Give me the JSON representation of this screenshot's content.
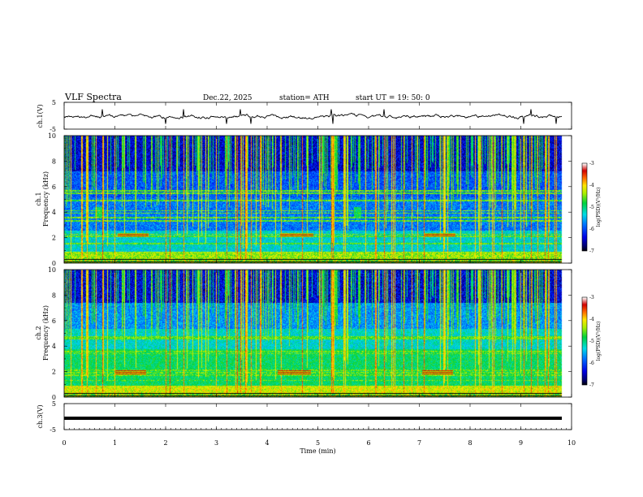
{
  "header": {
    "title": "VLF  Spectra",
    "date": "Dec.22, 2025",
    "station": "station= ATH",
    "start": "start  UT  =    19: 50: 0"
  },
  "chart_data": [
    {
      "id": "ch1-waveform",
      "type": "line",
      "ylabel": "ch.1(V)",
      "ylim": [
        -5,
        5
      ],
      "yticks": [
        5,
        -5
      ],
      "xlim": [
        0,
        10
      ],
      "data_extent_min": [
        0,
        9.8
      ],
      "series": [
        {
          "color": "#000000"
        }
      ]
    },
    {
      "id": "ch1-spectrogram",
      "type": "heatmap",
      "ylabel": "ch.1\nFrequency  (kHz)",
      "ylim": [
        0,
        10
      ],
      "yticks": [
        0,
        2,
        4,
        6,
        8,
        10
      ],
      "xlim": [
        0,
        10
      ],
      "data_extent_min": [
        0,
        9.8
      ],
      "colorbar": {
        "label": "log(PSD)(V²/Hz)",
        "range": [
          -7,
          -3
        ],
        "ticks": [
          "-3",
          "-4",
          "-5",
          "-6",
          "-7"
        ]
      },
      "features": {
        "tone_lines_khz": [
          5.7,
          5.5,
          4.95,
          4.9,
          4.15,
          3.95,
          3.6,
          3.35,
          2.3,
          2.15,
          1.55,
          0.9
        ],
        "band_blocks": [
          {
            "t": [
              1.05,
              1.65
            ],
            "f": [
              2.1,
              2.4
            ]
          },
          {
            "t": [
              4.25,
              4.9
            ],
            "f": [
              2.1,
              2.4
            ]
          },
          {
            "t": [
              7.1,
              7.7
            ],
            "f": [
              2.1,
              2.4
            ]
          }
        ],
        "whistler_patches": [
          {
            "t": [
              0.6,
              0.75
            ],
            "f": [
              3.6,
              4.4
            ]
          },
          {
            "t": [
              5.7,
              5.85
            ],
            "f": [
              3.6,
              4.4
            ]
          }
        ]
      }
    },
    {
      "id": "ch2-spectrogram",
      "type": "heatmap",
      "ylabel": "ch.2\nFrequency  (kHz)",
      "ylim": [
        0,
        10
      ],
      "yticks": [
        0,
        2,
        4,
        6,
        8,
        10
      ],
      "xlim": [
        0,
        10
      ],
      "data_extent_min": [
        0,
        9.8
      ],
      "colorbar": {
        "label": "log(PSD)(V²/Hz)",
        "range": [
          -7,
          -3
        ],
        "ticks": [
          "-3",
          "-4",
          "-5",
          "-6",
          "-7"
        ]
      },
      "features": {
        "tone_lines_khz": [
          4.75,
          4.6,
          3.6,
          3.45,
          2.15,
          1.95,
          1.75,
          1.35,
          0.85
        ],
        "band_blocks": [
          {
            "t": [
              1.0,
              1.6
            ],
            "f": [
              1.75,
              2.15
            ]
          },
          {
            "t": [
              4.2,
              4.85
            ],
            "f": [
              1.75,
              2.15
            ]
          },
          {
            "t": [
              7.05,
              7.65
            ],
            "f": [
              1.75,
              2.15
            ]
          }
        ]
      }
    },
    {
      "id": "ch3-waveform",
      "type": "line",
      "ylabel": "ch.3(V)",
      "ylim": [
        -5,
        5
      ],
      "yticks": [
        5,
        -5
      ],
      "xlim": [
        0,
        10
      ],
      "data_extent_min": [
        0,
        9.8
      ],
      "series": [
        {
          "color": "#000000"
        }
      ]
    }
  ],
  "x_axis": {
    "label": "Time  (min)",
    "ticks": [
      "0",
      "1",
      "2",
      "3",
      "4",
      "5",
      "6",
      "7",
      "8",
      "9",
      "10"
    ]
  }
}
